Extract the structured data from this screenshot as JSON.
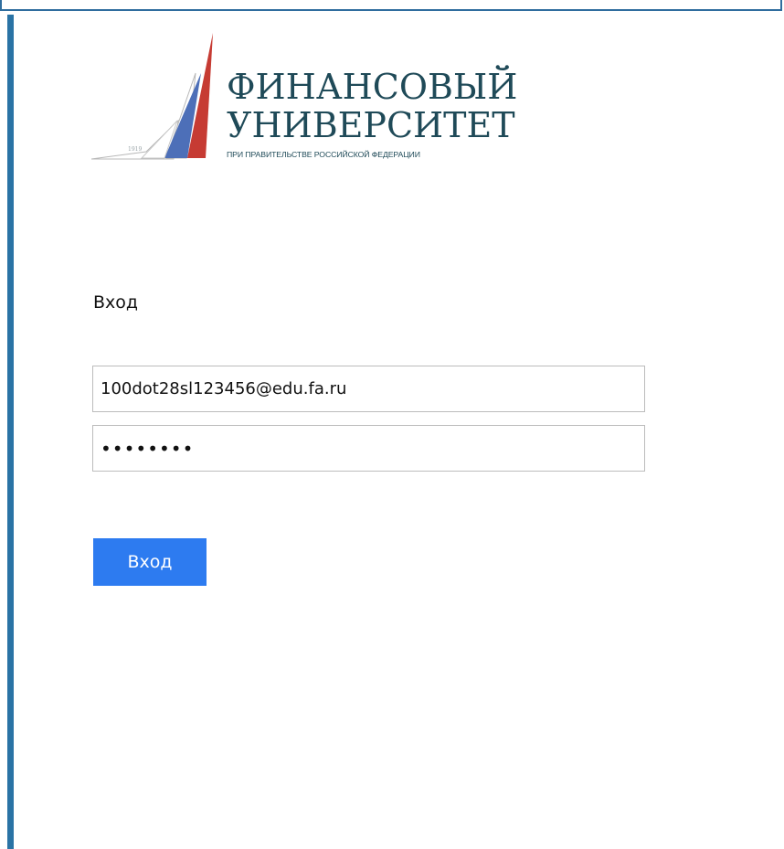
{
  "logo": {
    "line1": "ФИНАНСОВЫЙ",
    "line2": "УНИВЕРСИТЕТ",
    "subtitle": "ПРИ ПРАВИТЕЛЬСТВЕ РОССИЙСКОЙ ФЕДЕРАЦИИ",
    "year": "1919",
    "colors": {
      "text": "#1f4a58",
      "red": "#c63b33",
      "blue": "#4d6fb8",
      "gray": "#b8b8b8"
    }
  },
  "login": {
    "title": "Вход",
    "email_value": "100dot28sl123456@edu.fa.ru",
    "password_value": "password",
    "button_label": "Вход"
  },
  "theme": {
    "accent": "#2d7bf0",
    "left_bar": "#2a73a5"
  }
}
